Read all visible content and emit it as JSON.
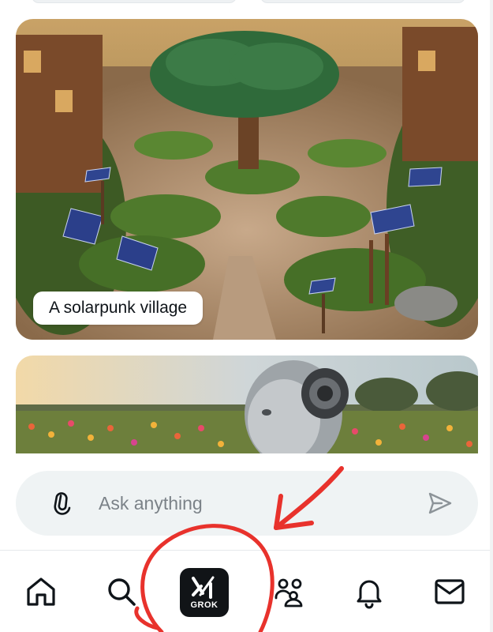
{
  "feed": {
    "cards": [
      {
        "caption": "A solarpunk village",
        "image": "solarpunk-village-image"
      },
      {
        "image": "robot-flower-field-image"
      }
    ]
  },
  "composer": {
    "placeholder": "Ask anything",
    "attach_icon": "paperclip-icon",
    "send_icon": "send-icon"
  },
  "tabbar": {
    "items": [
      {
        "icon": "home-icon"
      },
      {
        "icon": "search-icon"
      },
      {
        "icon": "grok-icon",
        "label": "GROK"
      },
      {
        "icon": "communities-icon"
      },
      {
        "icon": "bell-icon"
      },
      {
        "icon": "mail-icon"
      }
    ]
  },
  "annotation": {
    "shapes": [
      "red-circle",
      "red-arrow"
    ],
    "color": "#e8322c"
  },
  "colors": {
    "composer_bg": "#eff3f4",
    "grok_tile": "#111417",
    "text_primary": "#0f1419",
    "placeholder": "#7b8288"
  }
}
